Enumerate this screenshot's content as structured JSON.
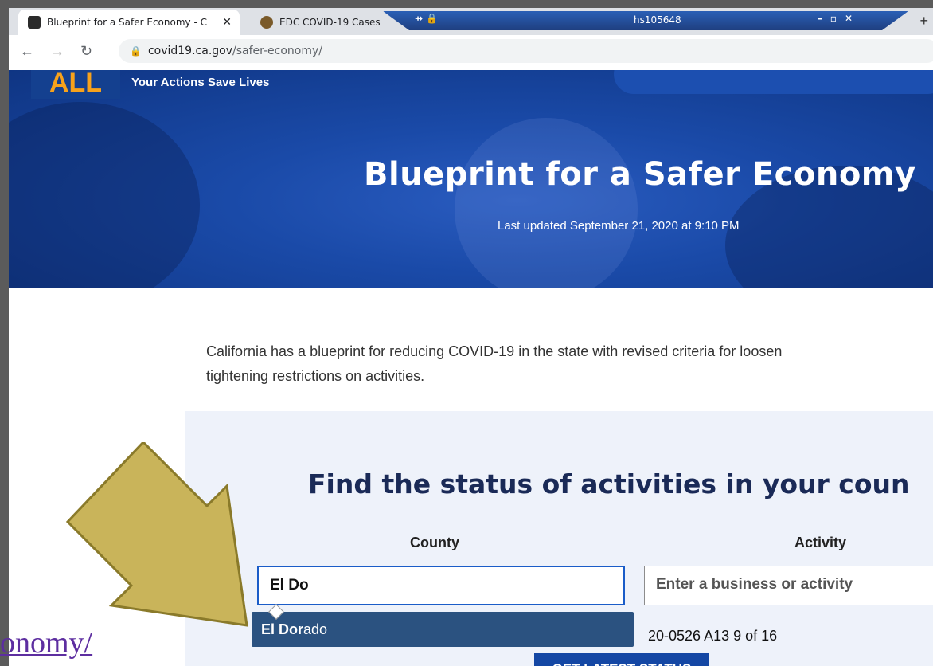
{
  "browser": {
    "tabs": [
      {
        "title": "Blueprint for a Safer Economy - C",
        "active": true
      },
      {
        "title": "EDC COVID-19 Cases",
        "active": false
      }
    ],
    "remote_host": "hs105648",
    "url_host": "covid19.ca.gov",
    "url_path": "/safer-economy/"
  },
  "header": {
    "logo": "ALL",
    "tagline": "Your Actions Save Lives"
  },
  "hero": {
    "title": "Blueprint for a Safer Economy",
    "updated": "Last updated September 21, 2020 at 9:10 PM"
  },
  "intro": {
    "line1": "California has a blueprint for reducing COVID-19 in the state with revised criteria for loosen",
    "line2": "tightening restrictions on activities."
  },
  "finder": {
    "heading": "Find the status of activities in your coun",
    "county_label": "County",
    "activity_label": "Activity",
    "county_value": "El Do",
    "activity_placeholder": "Enter a business or activity",
    "suggestion_match": "El Dor",
    "suggestion_rest": "ado",
    "button_label": "GET LATEST STATUS"
  },
  "overlay": {
    "slide_code": "20-0526 A13 9 of 16",
    "corner_url": "onomy/"
  },
  "colors": {
    "hero_blue": "#1a4aa8",
    "heading_navy": "#1a2a57",
    "arrow_gold": "#c9b45a"
  }
}
